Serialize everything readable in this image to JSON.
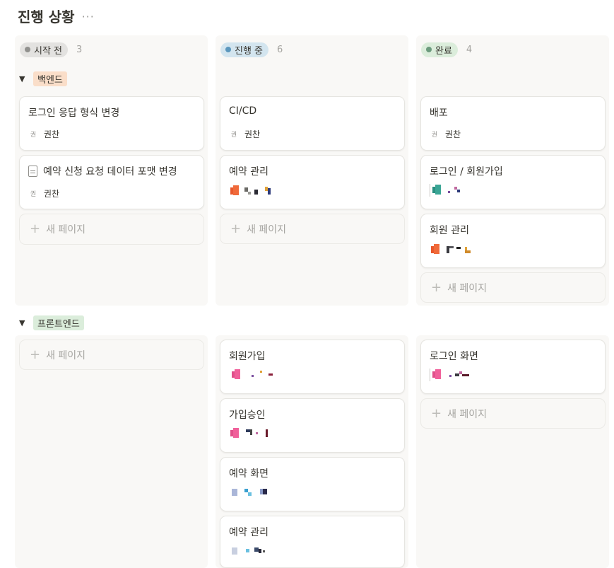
{
  "page": {
    "title": "진행 상황",
    "more_label": "···"
  },
  "columns": [
    {
      "status": "시작 전",
      "count": "3",
      "pill_bg": "#e3e2e0",
      "dot": "#91918e"
    },
    {
      "status": "진행 중",
      "count": "6",
      "pill_bg": "#d3e5ef",
      "dot": "#5b97bd"
    },
    {
      "status": "완료",
      "count": "4",
      "pill_bg": "#dbeddb",
      "dot": "#6c9b7d"
    }
  ],
  "groups": [
    {
      "name": "백엔드",
      "tag_bg": "#fadec9",
      "caret": "▼"
    },
    {
      "name": "프론트엔드",
      "tag_bg": "#dbeddb",
      "caret": "▼"
    }
  ],
  "cards": {
    "backend": {
      "todo": [
        {
          "title": "로그인 응답 형식 변경",
          "assignee": "권찬",
          "avatar": "권"
        },
        {
          "title": "예약 신청 요청 데이터 포맷 변경",
          "assignee": "권찬",
          "avatar": "권"
        }
      ],
      "doing": [
        {
          "title": "CI/CD",
          "assignee": "권찬",
          "avatar": "권"
        },
        {
          "title": "예약 관리"
        }
      ],
      "done": [
        {
          "title": "배포",
          "assignee": "권찬",
          "avatar": "권"
        },
        {
          "title": "로그인 / 회원가입"
        },
        {
          "title": "회원 관리"
        }
      ]
    },
    "frontend": {
      "doing": [
        {
          "title": "회원가입"
        },
        {
          "title": "가입승인"
        },
        {
          "title": "예약 화면"
        },
        {
          "title": "예약 관리"
        }
      ],
      "done": [
        {
          "title": "로그인 화면"
        }
      ]
    }
  },
  "new_page_label": "새 페이지",
  "new_page_icon": "+"
}
